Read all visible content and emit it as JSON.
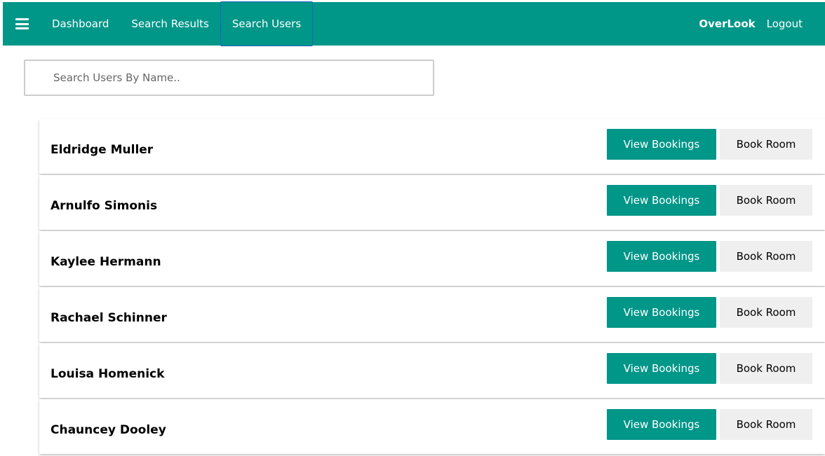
{
  "colors": {
    "accent": "#009688",
    "active_tab_border": "#1565c0",
    "secondary_button": "#efefef"
  },
  "header": {
    "menu_icon": "hamburger-menu-icon",
    "nav": [
      {
        "label": "Dashboard"
      },
      {
        "label": "Search Results"
      },
      {
        "label": "Search Users",
        "active": true
      }
    ],
    "brand": "OverLook",
    "logout_label": "Logout"
  },
  "search": {
    "placeholder": "Search Users By Name..",
    "value": ""
  },
  "users": [
    {
      "name": "Eldridge Muller",
      "view_label": "View Bookings",
      "book_label": "Book Room"
    },
    {
      "name": "Arnulfo Simonis",
      "view_label": "View Bookings",
      "book_label": "Book Room"
    },
    {
      "name": "Kaylee Hermann",
      "view_label": "View Bookings",
      "book_label": "Book Room"
    },
    {
      "name": "Rachael Schinner",
      "view_label": "View Bookings",
      "book_label": "Book Room"
    },
    {
      "name": "Louisa Homenick",
      "view_label": "View Bookings",
      "book_label": "Book Room"
    },
    {
      "name": "Chauncey Dooley",
      "view_label": "View Bookings",
      "book_label": "Book Room"
    }
  ]
}
